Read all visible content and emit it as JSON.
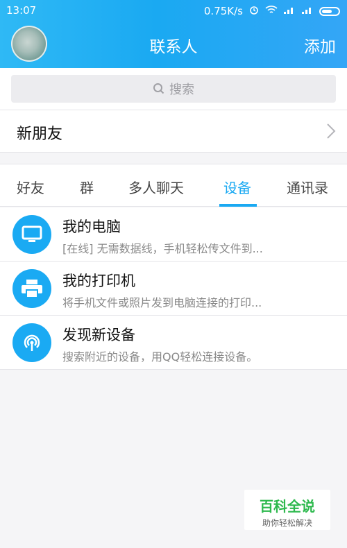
{
  "status": {
    "time": "13:07",
    "speed": "0.75K/s"
  },
  "header": {
    "title": "联系人",
    "add_label": "添加"
  },
  "search": {
    "placeholder": "搜索"
  },
  "new_friends": {
    "label": "新朋友"
  },
  "tabs": [
    {
      "label": "好友"
    },
    {
      "label": "群"
    },
    {
      "label": "多人聊天"
    },
    {
      "label": "设备"
    },
    {
      "label": "通讯录"
    }
  ],
  "active_tab": "设备",
  "devices": [
    {
      "name": "我的电脑",
      "desc": "[在线] 无需数据线，手机轻松传文件到...",
      "icon": "computer-icon"
    },
    {
      "name": "我的打印机",
      "desc": "将手机文件或照片发到电脑连接的打印...",
      "icon": "printer-icon"
    },
    {
      "name": "发现新设备",
      "desc": "搜索附近的设备，用QQ轻松连接设备。",
      "icon": "radar-icon"
    }
  ],
  "watermark": {
    "title": "百科全说",
    "subtitle": "助你轻松解决"
  },
  "colors": {
    "accent": "#1aa9f2",
    "header_start": "#2fb9f5",
    "header_end": "#34a6f6",
    "watermark_green": "#2db94d"
  }
}
